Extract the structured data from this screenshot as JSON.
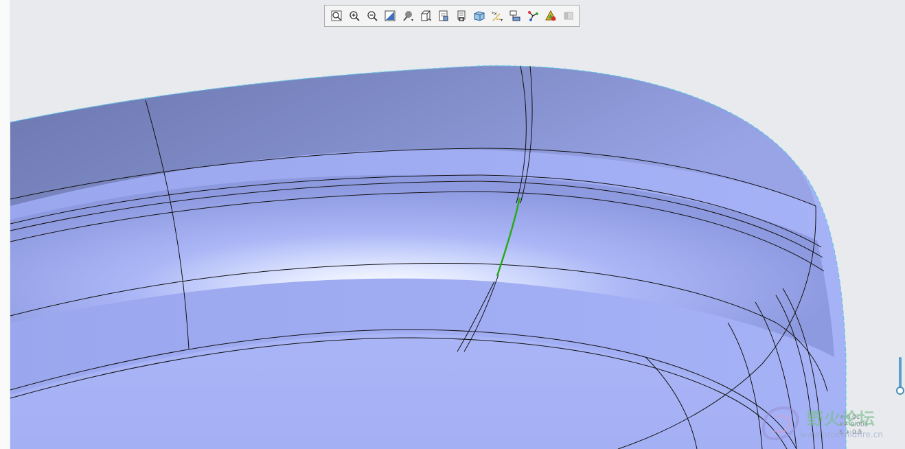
{
  "toolbar": {
    "buttons": [
      {
        "name": "refit-icon",
        "title": "Refit"
      },
      {
        "name": "zoom-in-icon",
        "title": "Zoom In"
      },
      {
        "name": "zoom-out-icon",
        "title": "Zoom Out"
      },
      {
        "name": "repaint-icon",
        "title": "Repaint"
      },
      {
        "name": "display-style-icon",
        "title": "Display Style"
      },
      {
        "name": "saved-orientations-icon",
        "title": "Saved Orientations"
      },
      {
        "name": "view-manager-icon",
        "title": "View Manager"
      },
      {
        "name": "perspective-view-icon",
        "title": "Perspective View"
      },
      {
        "name": "section-view-icon",
        "title": "Section View"
      },
      {
        "name": "datum-display-icon",
        "title": "Datum Display Filters"
      },
      {
        "name": "annotation-display-icon",
        "title": "Annotation Display"
      },
      {
        "name": "spin-center-icon",
        "title": "Spin Center"
      },
      {
        "name": "analysis-icon",
        "title": "Analysis"
      },
      {
        "name": "disabled-tool-icon",
        "title": "Disabled"
      }
    ]
  },
  "watermark": {
    "title": "野火论坛",
    "url": "www.proewildfire.cn"
  },
  "tolerance": {
    "lines": [
      "+ 0.01",
      "X+ 0.001",
      "S + 0.5"
    ]
  },
  "colors": {
    "background": "#e9eaee",
    "surface_dark": "#6d78b0",
    "surface_mid": "#a6b2f6",
    "surface_highlight": "#ffffff",
    "edge_line": "#111111",
    "highlight_edge": "#2aa818",
    "silhouette": "#5fc8e6"
  }
}
